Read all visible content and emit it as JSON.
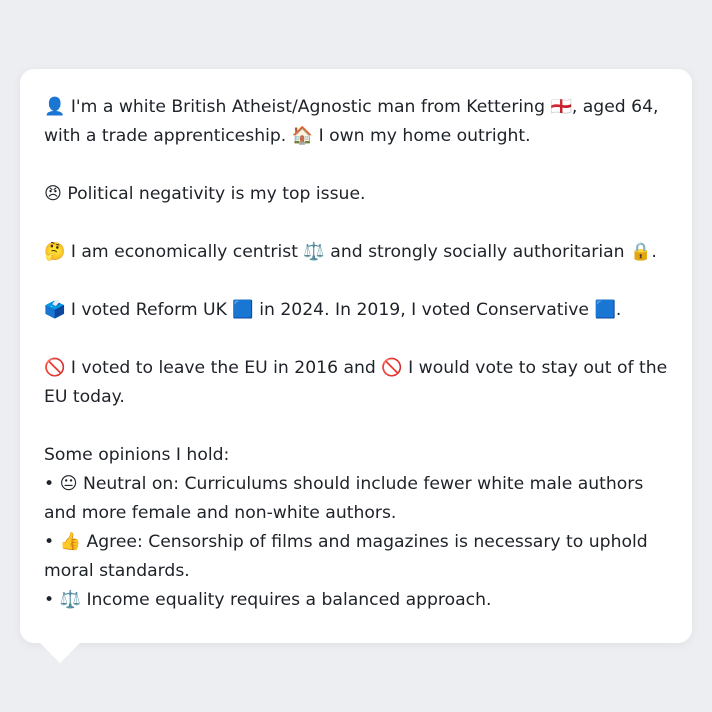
{
  "profile": {
    "identity": "👤 I'm a white British Atheist/Agnostic man from Kettering 🏴󠁧󠁢󠁥󠁮󠁧󠁿, aged 64, with a trade apprenticeship. 🏠 I own my home outright.",
    "top_issue": "😠 Political negativity is my top issue.",
    "ideology": "🤔 I am economically centrist ⚖️ and strongly socially authoritarian 🔒.",
    "votes": "🗳️ I voted Reform UK 🟦 in 2024. In 2019, I voted Conservative 🟦.",
    "eu": "🚫 I voted to leave the EU in 2016 and 🚫 I would vote to stay out of the EU today.",
    "opinions_heading": "Some opinions I hold:",
    "opinions": [
      "• 😐 Neutral on: Curriculums should include fewer white male authors and more female and non-white authors.",
      "• 👍 Agree: Censorship of films and magazines is necessary to uphold moral standards.",
      "• ⚖️ Income equality requires a balanced approach."
    ]
  }
}
